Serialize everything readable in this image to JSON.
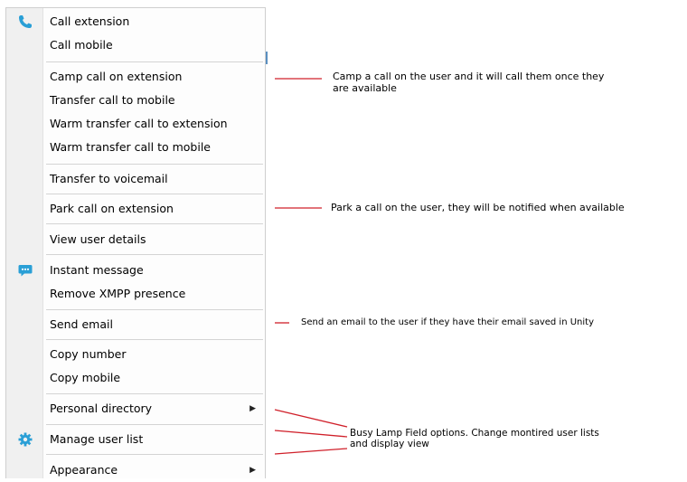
{
  "menu": {
    "items": [
      {
        "label": "Call extension",
        "icon": "phone-icon"
      },
      {
        "label": "Call mobile"
      },
      {
        "label": "Camp call on extension"
      },
      {
        "label": "Transfer call to mobile"
      },
      {
        "label": "Warm transfer call to extension"
      },
      {
        "label": "Warm transfer call to mobile"
      },
      {
        "label": "Transfer to voicemail"
      },
      {
        "label": "Park call on extension"
      },
      {
        "label": "View user details"
      },
      {
        "label": "Instant message",
        "icon": "chat-icon"
      },
      {
        "label": "Remove XMPP presence"
      },
      {
        "label": "Send email"
      },
      {
        "label": "Copy number"
      },
      {
        "label": "Copy mobile"
      },
      {
        "label": "Personal directory",
        "submenu": "right-arrow-icon"
      },
      {
        "label": "Manage user list",
        "icon": "gear-icon"
      },
      {
        "label": "Appearance",
        "submenu": "right-arrow-icon"
      }
    ]
  },
  "annotations": {
    "camp_line1": "Camp a call on the user and it will call them once they",
    "camp_line2": "are available",
    "park": "Park a call on the user, they will be notified when available",
    "email": "Send an email to the user if they have their email saved in Unity",
    "blf_line1": "Busy Lamp Field options. Change montired user lists",
    "blf_line2": "and display view"
  },
  "colors": {
    "annotation_line": "#d0202a",
    "icon_blue": "#2a9fd6"
  }
}
